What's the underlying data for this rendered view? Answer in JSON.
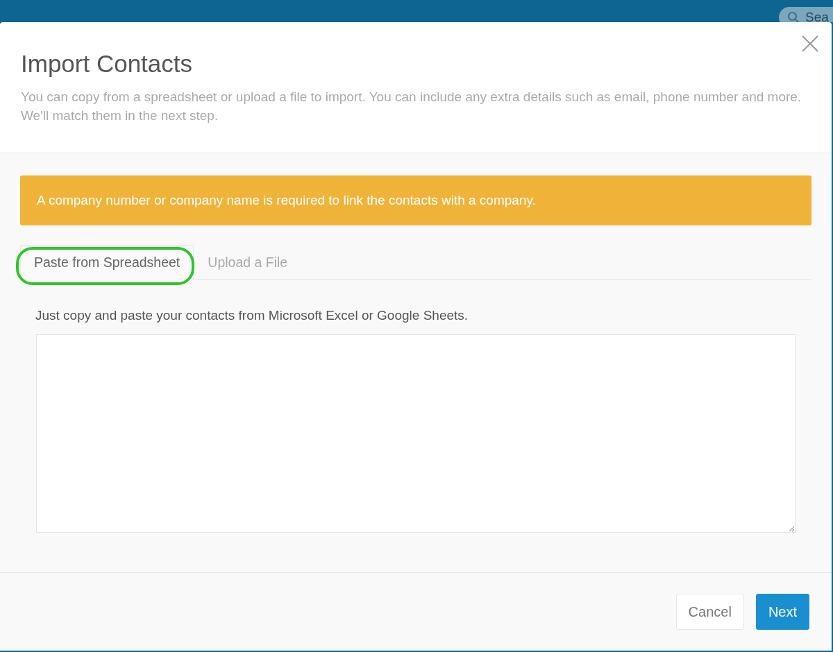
{
  "top_bar": {
    "search": {
      "placeholder": "Sea"
    }
  },
  "dialog": {
    "title": "Import Contacts",
    "description": "You can copy from a spreadsheet or upload a file to import. You can include any extra details such as email, phone number and more. We'll match them in the next step.",
    "alert": {
      "kind": "warning",
      "text": "A company number or company name is required to link the contacts with a company."
    },
    "tabs": [
      {
        "label": "Paste from Spreadsheet",
        "selected": true,
        "highlighted": true
      },
      {
        "label": "Upload a File",
        "selected": false,
        "highlighted": false
      }
    ],
    "instructions": "Just copy and paste your contacts from Microsoft Excel or Google Sheets.",
    "buttons": [
      {
        "label": "Cancel",
        "kind": "default"
      },
      {
        "label": "Next",
        "kind": "primary"
      }
    ]
  }
}
